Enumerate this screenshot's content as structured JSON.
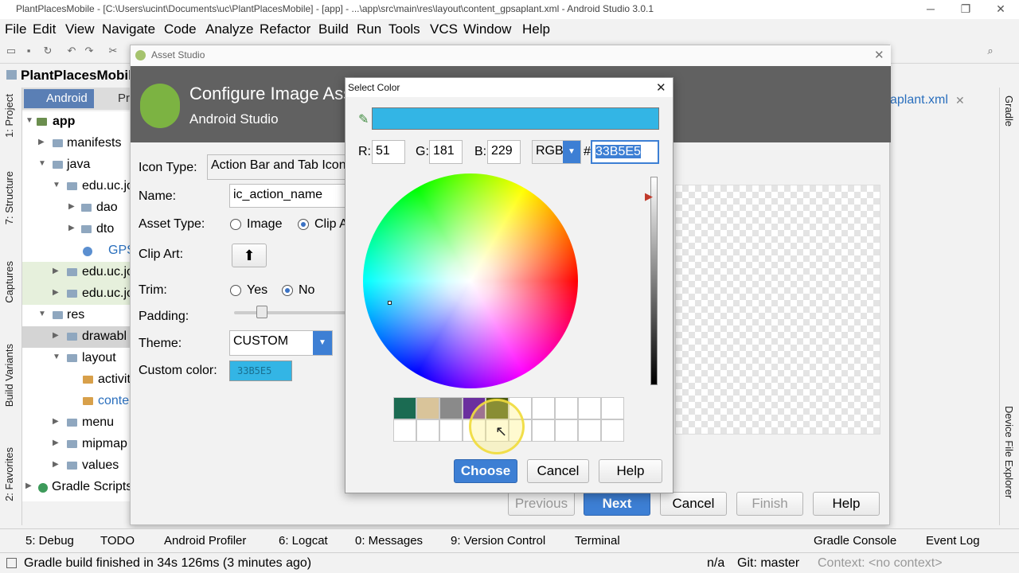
{
  "window": {
    "title": "PlantPlacesMobile - [C:\\Users\\ucint\\Documents\\uc\\PlantPlacesMobile] - [app] - ...\\app\\src\\main\\res\\layout\\content_gpsaplant.xml - Android Studio 3.0.1",
    "minimize": "─",
    "restore": "❐",
    "close": "✕"
  },
  "menu": [
    "File",
    "Edit",
    "View",
    "Navigate",
    "Code",
    "Analyze",
    "Refactor",
    "Build",
    "Run",
    "Tools",
    "VCS",
    "Window",
    "Help"
  ],
  "navbar": {
    "project": "PlantPlacesMobil"
  },
  "project_panel": {
    "tab_android": "Android",
    "tab_other": "Pro",
    "tree": [
      "app",
      "manifests",
      "java",
      "edu.uc.jo",
      "dao",
      "dto",
      "GPS",
      "edu.uc.jo",
      "edu.uc.jo",
      "res",
      "drawabl",
      "layout",
      "activit",
      "conte",
      "menu",
      "mipmap",
      "values",
      "Gradle Scripts"
    ]
  },
  "left_tabs": [
    "1: Project",
    "7: Structure",
    "Captures",
    "Build Variants",
    "2: Favorites"
  ],
  "right_tabs": [
    "Gradle",
    "Device File Explorer"
  ],
  "editor_tab": "aplant.xml",
  "asset_studio": {
    "title": "Asset Studio",
    "header_title": "Configure Image Asset",
    "header_sub": "Android Studio",
    "icon_type_label": "Icon Type:",
    "icon_type_value": "Action Bar and Tab Icons",
    "name_label": "Name:",
    "name_value": "ic_action_name",
    "asset_type_label": "Asset Type:",
    "asset_image": "Image",
    "asset_clip": "Clip Art",
    "clip_art_label": "Clip Art:",
    "trim_label": "Trim:",
    "trim_yes": "Yes",
    "trim_no": "No",
    "padding_label": "Padding:",
    "padding_percent": 25,
    "theme_label": "Theme:",
    "theme_value": "CUSTOM",
    "custom_color_label": "Custom color:",
    "custom_color_value": "33B5E5",
    "btn_previous": "Previous",
    "btn_next": "Next",
    "btn_cancel": "Cancel",
    "btn_finish": "Finish",
    "btn_help": "Help"
  },
  "select_color": {
    "title": "Select Color",
    "preview_color": "#33B5E5",
    "r_label": "R:",
    "r_value": "51",
    "g_label": "G:",
    "g_value": "181",
    "b_label": "B:",
    "b_value": "229",
    "mode": "RGB",
    "hash": "#",
    "hex_value": "33B5E5",
    "recent_colors": [
      "#1b6b52",
      "#d9c49a",
      "#8a8a8a",
      "#6a2f9e",
      "#4a5a10"
    ],
    "btn_choose": "Choose",
    "btn_cancel": "Cancel",
    "btn_help": "Help"
  },
  "bottom_tools": [
    "5: Debug",
    "TODO",
    "Android Profiler",
    "6: Logcat",
    "0: Messages",
    "9: Version Control",
    "Terminal",
    "Gradle Console",
    "Event Log"
  ],
  "status": {
    "message": "Gradle build finished in 34s 126ms (3 minutes ago)",
    "position": "n/a",
    "git": "Git: master",
    "context": "Context: <no context>"
  }
}
